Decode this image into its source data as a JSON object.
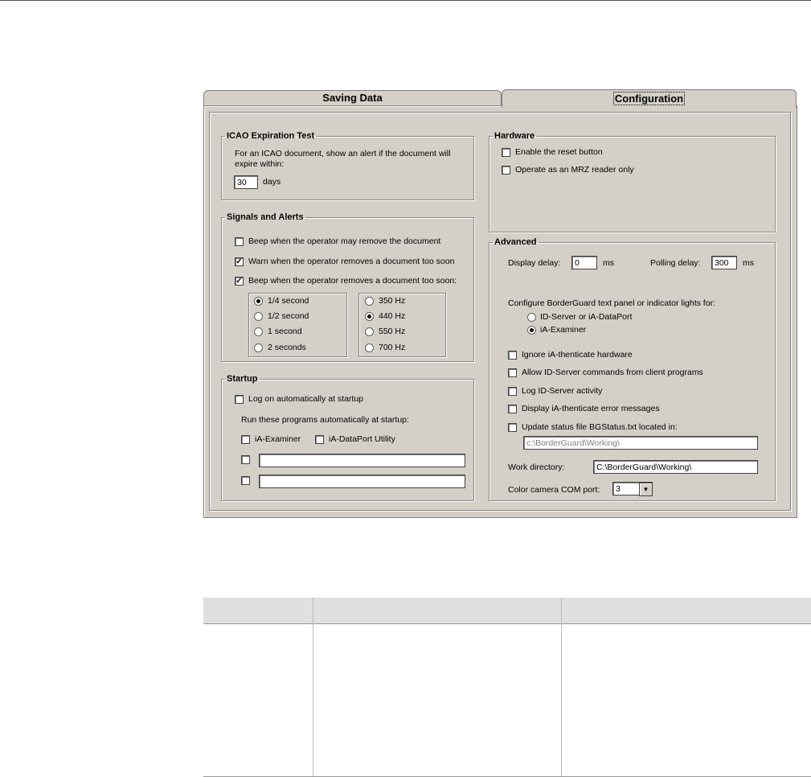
{
  "tabs": {
    "saving_data": "Saving Data",
    "configuration": "Configuration"
  },
  "icao": {
    "title": "ICAO Expiration Test",
    "desc_line1": "For an ICAO document, show an alert if the document will",
    "desc_line2": "expire within:",
    "days_value": "30",
    "days_unit": "days"
  },
  "signals": {
    "title": "Signals and Alerts",
    "beep_remove": "Beep when the operator may remove the document",
    "warn_soon": "Warn when the operator removes a document too soon",
    "beep_soon": "Beep when the operator removes a document too soon:",
    "beep_remove_checked": false,
    "warn_soon_checked": true,
    "beep_soon_checked": true,
    "durations": [
      "1/4 second",
      "1/2 second",
      "1 second",
      "2 seconds"
    ],
    "duration_selected": "1/4 second",
    "frequencies": [
      "350 Hz",
      "440 Hz",
      "550 Hz",
      "700 Hz"
    ],
    "frequency_selected": "440 Hz"
  },
  "startup": {
    "title": "Startup",
    "logon_auto": "Log on automatically at startup",
    "run_programs": "Run these programs automatically at startup:",
    "ia_examiner": "iA-Examiner",
    "ia_dataport": "iA-DataPort Utility",
    "custom1": "",
    "custom2": ""
  },
  "hardware": {
    "title": "Hardware",
    "enable_reset": "Enable the reset button",
    "mrz_only": "Operate as an MRZ reader only"
  },
  "advanced": {
    "title": "Advanced",
    "display_delay_label": "Display delay:",
    "display_delay_value": "0",
    "display_delay_unit": "ms",
    "polling_delay_label": "Polling delay:",
    "polling_delay_value": "300",
    "polling_delay_unit": "ms",
    "configure_label": "Configure BorderGuard text panel or indicator lights for:",
    "option_idserver": "ID-Server or iA-DataPort",
    "option_examiner": "iA-Examiner",
    "option_selected": "iA-Examiner",
    "ignore_hw": "Ignore iA-thenticate hardware",
    "allow_cmds": "Allow ID-Server commands from client programs",
    "log_activity": "Log ID-Server activity",
    "display_errors": "Display iA-thenticate error messages",
    "update_status": "Update status file BGStatus.txt located in:",
    "status_path": "c:\\BorderGuard\\Working\\",
    "work_dir_label": "Work directory:",
    "work_dir_value": "C:\\BorderGuard\\Working\\",
    "com_port_label": "Color camera COM port:",
    "com_port_value": "3"
  },
  "colors": {
    "dialog_bg": "#d4d0c8",
    "table_header_bg": "#e0e0e0"
  }
}
